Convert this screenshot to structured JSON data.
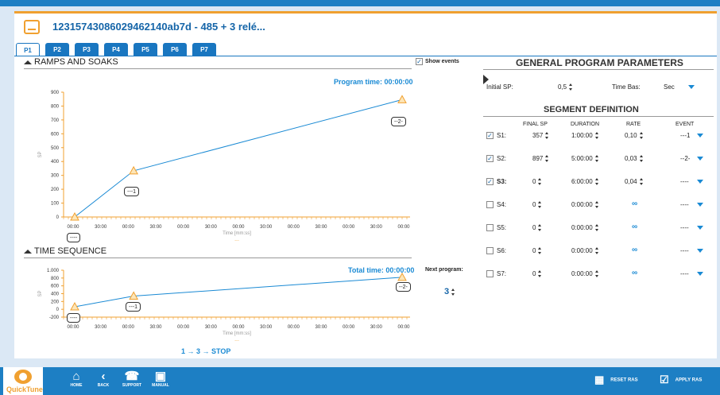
{
  "window": {
    "title": "12315743086029462140ab7d - 485 + 3 relé..."
  },
  "tabs": [
    "P1",
    "P2",
    "P3",
    "P4",
    "P5",
    "P6",
    "P7"
  ],
  "ramps": {
    "heading": "RAMPS AND SOAKS",
    "show_events_label": "Show events",
    "program_time_label": "Program time: 00:00:00",
    "y_axis_label": "SP",
    "x_axis_label": "Time [mm:ss]",
    "y_ticks": [
      "900",
      "800",
      "700",
      "600",
      "500",
      "400",
      "300",
      "200",
      "100",
      "0"
    ],
    "x_ticks": [
      "00:00",
      "30:00",
      "00:00",
      "30:00",
      "00:00",
      "30:00",
      "00:00",
      "30:00",
      "00:00",
      "30:00",
      "00:00",
      "30:00",
      "00:00"
    ],
    "callouts": [
      "----",
      "---1",
      "--2-"
    ],
    "dash": "..."
  },
  "time_sequence": {
    "heading": "TIME SEQUENCE",
    "total_time_label": "Total time: 00:00:00",
    "y_axis_label": "SP",
    "x_axis_label": "Time [mm:ss]",
    "y_ticks": [
      "1.000",
      "800",
      "600",
      "400",
      "200",
      "0",
      "-200"
    ],
    "x_ticks": [
      "00:00",
      "30:00",
      "00:00",
      "30:00",
      "00:00",
      "30:00",
      "00:00",
      "30:00",
      "00:00",
      "30:00",
      "00:00",
      "30:00",
      "00:00"
    ],
    "callouts": [
      "----",
      "---1",
      "--2-"
    ],
    "sequence_text": "1 → 3 → STOP",
    "dash": "..."
  },
  "next_program": {
    "label": "Next program:",
    "value": "3"
  },
  "general": {
    "heading": "GENERAL PROGRAM PARAMETERS",
    "initial_sp_label": "Initial SP:",
    "initial_sp_value": "0,5",
    "time_base_label": "Time Bas:",
    "time_base_value": "Sec"
  },
  "segments": {
    "heading": "SEGMENT DEFINITION",
    "columns": [
      "FINAL SP",
      "DURATION",
      "RATE",
      "EVENT"
    ],
    "rows": [
      {
        "name": "S1:",
        "checked": true,
        "final_sp": "357",
        "duration": "1:00:00",
        "rate": "0,10",
        "event": "---1"
      },
      {
        "name": "S2:",
        "checked": true,
        "final_sp": "897",
        "duration": "5:00:00",
        "rate": "0,03",
        "event": "--2-"
      },
      {
        "name": "S3:",
        "checked": true,
        "final_sp": "0",
        "duration": "6:00:00",
        "rate": "0,04",
        "event": "----"
      },
      {
        "name": "S4:",
        "checked": false,
        "final_sp": "0",
        "duration": "0:00:00",
        "rate": "∞",
        "event": "----"
      },
      {
        "name": "S5:",
        "checked": false,
        "final_sp": "0",
        "duration": "0:00:00",
        "rate": "∞",
        "event": "----"
      },
      {
        "name": "S6:",
        "checked": false,
        "final_sp": "0",
        "duration": "0:00:00",
        "rate": "∞",
        "event": "----"
      },
      {
        "name": "S7:",
        "checked": false,
        "final_sp": "0",
        "duration": "0:00:00",
        "rate": "∞",
        "event": "----"
      }
    ]
  },
  "footer": {
    "logo_text": "QuickTune",
    "home": "HOME",
    "back": "BACK",
    "support": "SUPPORT",
    "manual": "MANUAL",
    "reset": "RESET RAS",
    "apply": "APPLY RAS"
  },
  "colors": {
    "accent": "#1d7fc4",
    "orange": "#f0a030",
    "line": "#1a8ad4"
  }
}
